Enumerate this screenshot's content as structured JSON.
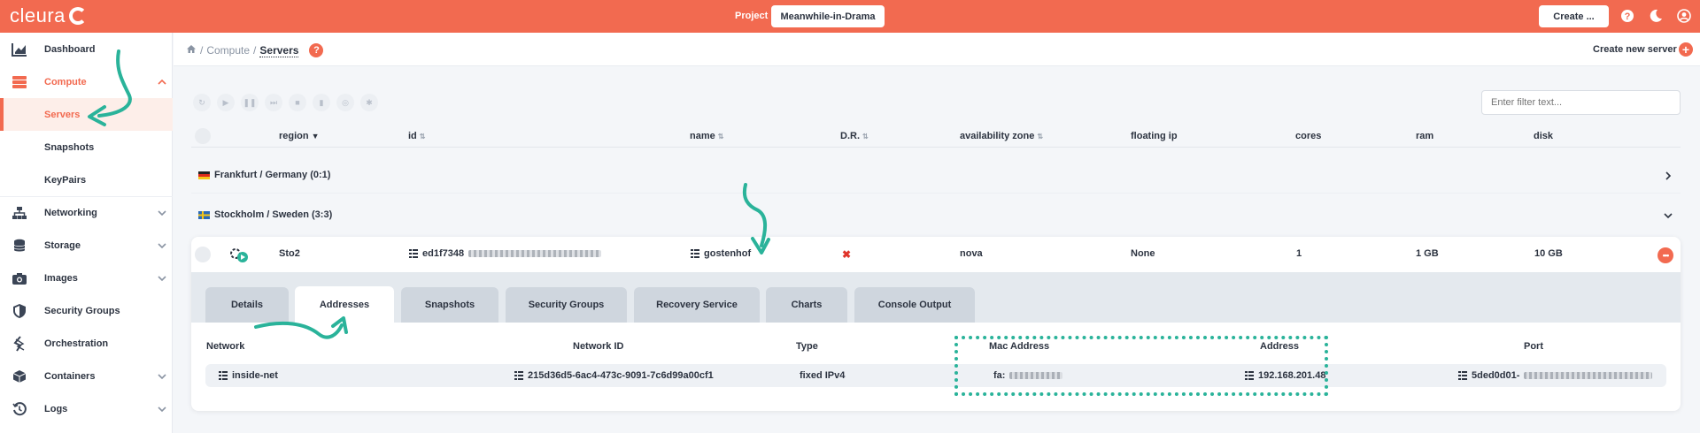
{
  "topbar": {
    "logo_text": "cleura",
    "project_label": "Project",
    "project_name": "Meanwhile-in-Drama",
    "create_label": "Create ...",
    "icons": [
      "help-icon",
      "moon-icon",
      "user-icon"
    ]
  },
  "sidebar": {
    "items": [
      {
        "label": "Dashboard",
        "icon": "chart-icon"
      },
      {
        "label": "Compute",
        "icon": "server-stack-icon"
      },
      {
        "label": "Servers"
      },
      {
        "label": "Snapshots"
      },
      {
        "label": "KeyPairs"
      },
      {
        "label": "Networking",
        "icon": "network-icon"
      },
      {
        "label": "Storage",
        "icon": "database-icon"
      },
      {
        "label": "Images",
        "icon": "camera-icon"
      },
      {
        "label": "Security Groups",
        "icon": "shield-icon"
      },
      {
        "label": "Orchestration",
        "icon": "layers-icon"
      },
      {
        "label": "Containers",
        "icon": "cube-icon"
      },
      {
        "label": "Logs",
        "icon": "history-icon"
      }
    ]
  },
  "breadcrumb": {
    "sep": "/",
    "compute": "Compute",
    "current": "Servers",
    "help": "?"
  },
  "actions": {
    "create_server": "Create new server"
  },
  "filter": {
    "placeholder": "Enter filter text..."
  },
  "table": {
    "columns": [
      "region",
      "id",
      "name",
      "D.R.",
      "availability zone",
      "floating ip",
      "cores",
      "ram",
      "disk"
    ],
    "groups": [
      {
        "label": "Frankfurt / Germany (0:1)"
      },
      {
        "label": "Stockholm / Sweden (3:3)"
      }
    ],
    "server": {
      "region": "Sto2",
      "id_prefix": "ed1f7348",
      "name": "gostenhof",
      "dr": "✖",
      "availability_zone": "nova",
      "floating_ip": "None",
      "cores": "1",
      "ram": "1 GB",
      "disk": "10 GB",
      "more": "•••"
    }
  },
  "tabs": [
    "Details",
    "Addresses",
    "Snapshots",
    "Security Groups",
    "Recovery Service",
    "Charts",
    "Console Output"
  ],
  "addresses": {
    "headers": [
      "Network",
      "Network ID",
      "Type",
      "Mac Address",
      "Address",
      "Port"
    ],
    "row": {
      "network": "inside-net",
      "network_id": "215d36d5-6ac4-473c-9091-7c6d99a00cf1",
      "type": "fixed IPv4",
      "mac_prefix": "fa:",
      "address": "192.168.201.48",
      "port_prefix": "5ded0d01-"
    }
  },
  "colors": {
    "brand": "#f26a50",
    "annotation": "#2ab39a"
  }
}
